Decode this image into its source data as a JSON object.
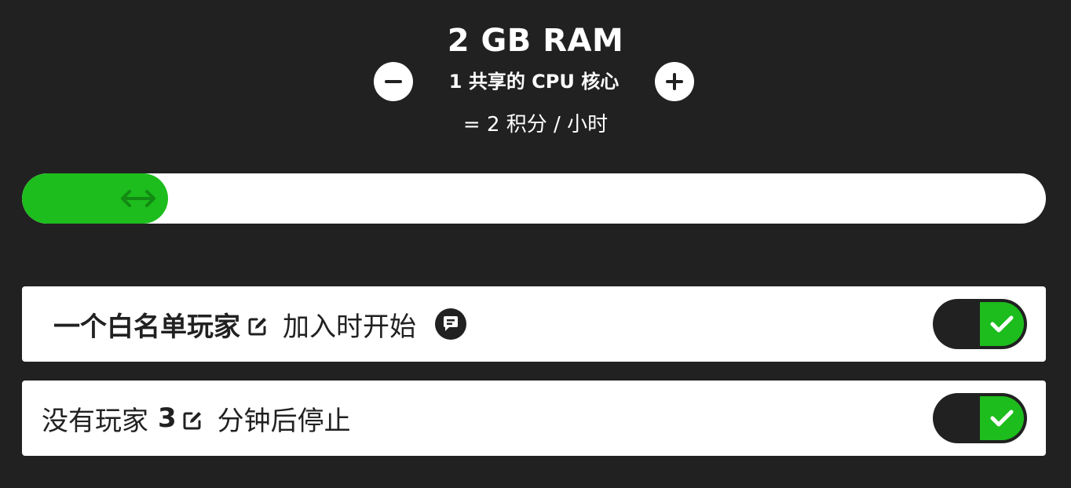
{
  "plan": {
    "ram_label": "2 GB RAM",
    "cpu_label": "1 共享的 CPU 核心",
    "credits_label": "= 2 积分 / 小时"
  },
  "slider": {
    "value_fraction": 0.143
  },
  "options": {
    "whitelist_start": {
      "prefix": "一个白名单玩家",
      "suffix": "加入时开始",
      "enabled": true
    },
    "idle_stop": {
      "prefix": "没有玩家",
      "minutes": "3",
      "suffix": "分钟后停止",
      "enabled": true
    }
  },
  "colors": {
    "background": "#212121",
    "accent": "#1cbd1c",
    "surface": "#ffffff"
  },
  "icons": {
    "decrease": "minus-icon",
    "increase": "plus-icon",
    "slider_handle": "arrows-horizontal-icon",
    "edit": "edit-icon",
    "chat": "chat-bubble-icon",
    "check": "check-icon"
  }
}
